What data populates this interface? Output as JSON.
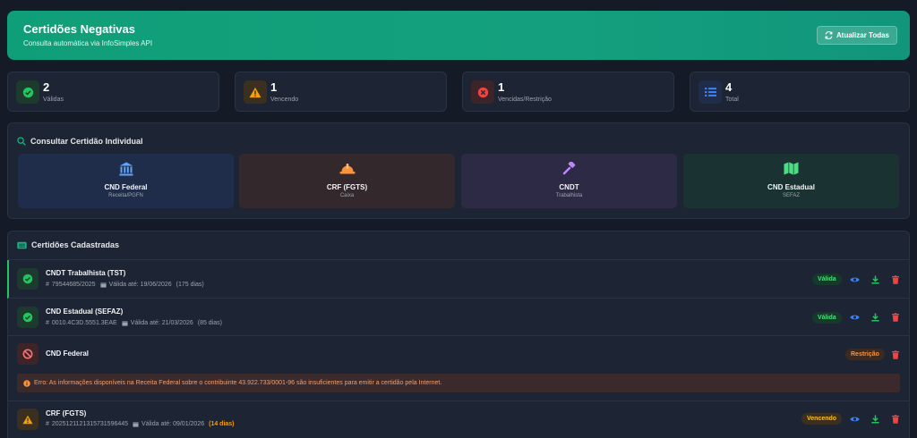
{
  "header": {
    "title": "Certidões Negativas",
    "subtitle": "Consulta automática via InfoSimples API",
    "refresh_label": "Atualizar Todas"
  },
  "stats": [
    {
      "value": "2",
      "label": "Válidas",
      "icon": "check-circle-icon",
      "color": "#22c55e"
    },
    {
      "value": "1",
      "label": "Vencendo",
      "icon": "warning-icon",
      "color": "#f59e0b"
    },
    {
      "value": "1",
      "label": "Vencidas/Restrição",
      "icon": "x-circle-icon",
      "color": "#ef4444"
    },
    {
      "value": "4",
      "label": "Total",
      "icon": "list-icon",
      "color": "#3b82f6"
    }
  ],
  "consult": {
    "title": "Consultar Certidão Individual",
    "cards": [
      {
        "name": "CND Federal",
        "org": "Receita/PGFN",
        "icon": "bank-icon",
        "color": "#60a5fa"
      },
      {
        "name": "CRF (FGTS)",
        "org": "Caixa",
        "icon": "hard-hat-icon",
        "color": "#fb923c"
      },
      {
        "name": "CNDT",
        "org": "Trabalhista",
        "icon": "gavel-icon",
        "color": "#c084fc"
      },
      {
        "name": "CND Estadual",
        "org": "SEFAZ",
        "icon": "map-icon",
        "color": "#4ade80"
      }
    ]
  },
  "registered": {
    "title": "Certidões Cadastradas",
    "items": [
      {
        "name": "CNDT Trabalhista (TST)",
        "number": "79544685/2025",
        "valid_until": "Válida até: 19/06/2026",
        "days": "(175 dias)",
        "status": "Válida"
      },
      {
        "name": "CND Estadual (SEFAZ)",
        "number": "0010.4C3D.5551.3EAE",
        "valid_until": "Válida até: 21/03/2026",
        "days": "(85 dias)",
        "status": "Válida"
      },
      {
        "name": "CND Federal",
        "status": "Restrição",
        "error": "Erro: As informações disponíveis na Receita Federal sobre o contribuinte 43.922.733/0001-96 são insuficientes para emitir a certidão pela Internet."
      },
      {
        "name": "CRF (FGTS)",
        "number": "2025121121315731596445",
        "valid_until": "Válida até: 09/01/2026",
        "days": "(14 dias)",
        "status": "Vencendo"
      }
    ]
  },
  "colors": {
    "accent": "#10a37f",
    "valid": "#22c55e",
    "warning": "#f59e0b",
    "danger": "#ef4444"
  }
}
